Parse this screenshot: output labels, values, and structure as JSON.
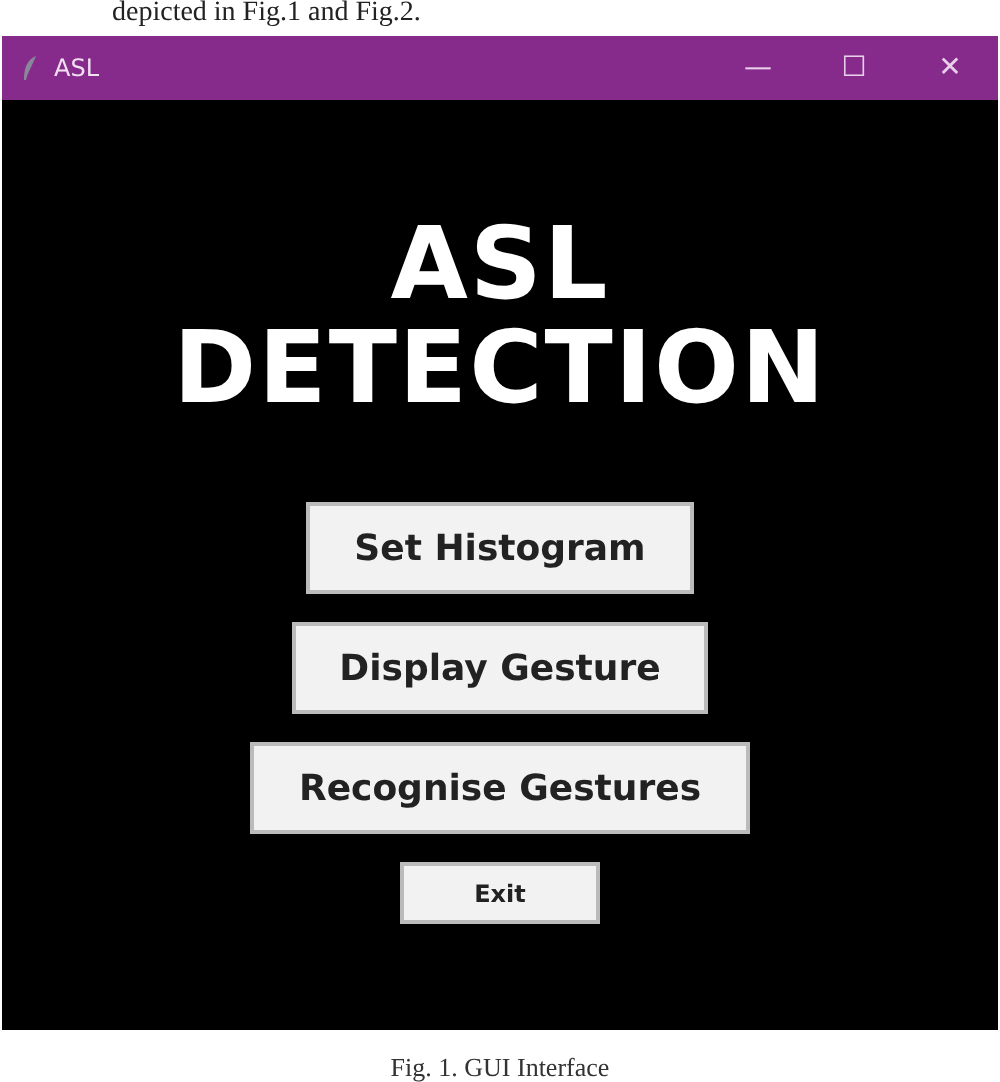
{
  "page_text": "depicted in Fig.1 and Fig.2.",
  "window": {
    "title": "ASL",
    "controls": [
      "—",
      "☐",
      "✕"
    ]
  },
  "heading": [
    "ASL",
    "DETECTION"
  ],
  "buttons": [
    {
      "label": "Set Histogram",
      "kind": "large"
    },
    {
      "label": "Display Gesture",
      "kind": "large"
    },
    {
      "label": "Recognise Gestures",
      "kind": "large"
    },
    {
      "label": "Exit",
      "kind": "small"
    }
  ],
  "caption": "Fig. 1. GUI Interface"
}
